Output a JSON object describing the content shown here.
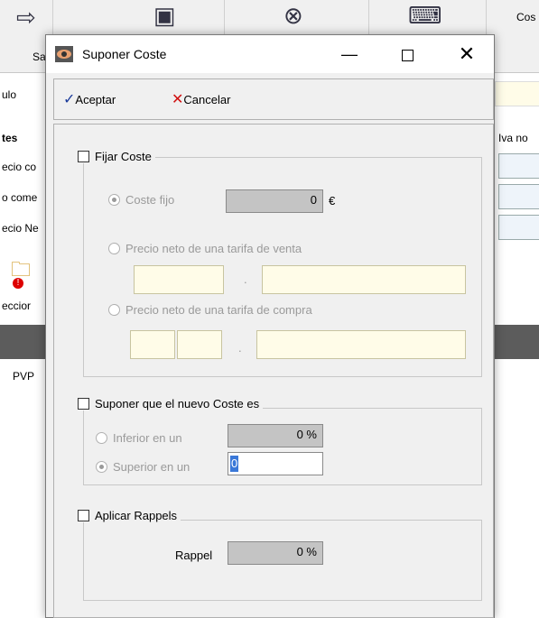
{
  "background": {
    "toolbar": {
      "labels": [
        "Sa",
        "Cos"
      ]
    },
    "left_labels": [
      "ulo",
      "tes",
      "ecio co",
      "o come",
      "ecio Ne",
      "eccior",
      "PVP"
    ],
    "right_labels": [
      "Iva no"
    ]
  },
  "dialog": {
    "title": "Suponer Coste",
    "actions": {
      "accept_label": "Aceptar",
      "cancel_label": "Cancelar"
    },
    "fijar_coste": {
      "legend": "Fijar Coste",
      "coste_fijo_label": "Coste fijo",
      "coste_fijo_value": "0",
      "currency_symbol": "€",
      "precio_venta_label": "Precio neto de una tarifa de venta",
      "precio_compra_label": "Precio neto de una tarifa de compra",
      "separator": "."
    },
    "suponer": {
      "legend": "Suponer que el nuevo Coste es",
      "inferior_label": "Inferior en un",
      "inferior_value": "0 %",
      "superior_label": "Superior en un",
      "superior_value": "0"
    },
    "rappels": {
      "legend": "Aplicar Rappels",
      "rappel_label": "Rappel",
      "rappel_value": "0 %"
    }
  },
  "colors": {
    "accept_check": "#1a3a9a",
    "cancel_x": "#d01010",
    "selection_highlight": "#3a78d8"
  }
}
